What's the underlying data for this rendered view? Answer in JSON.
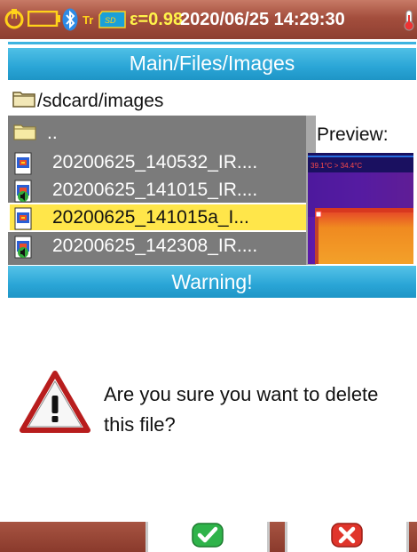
{
  "status_bar": {
    "emissivity": "ε=0.98",
    "datetime": "2020/06/25 14:29:30",
    "icons": [
      "power-plug-icon",
      "battery-icon",
      "bluetooth-icon",
      "temperature-unit-icon",
      "sd-card-icon",
      "thermometer-icon"
    ]
  },
  "header": {
    "breadcrumb": "Main/Files/Images"
  },
  "path": {
    "value": "/sdcard/images"
  },
  "file_list": {
    "items": [
      {
        "label": "..",
        "type": "folder",
        "selected": false
      },
      {
        "label": "20200625_140532_IR....",
        "type": "ir-image",
        "selected": false
      },
      {
        "label": "20200625_141015_IR....",
        "type": "ir-image-audio",
        "selected": false
      },
      {
        "label": "20200625_141015a_I...",
        "type": "ir-image",
        "selected": true
      },
      {
        "label": "20200625_142308_IR....",
        "type": "ir-image-audio",
        "selected": false
      }
    ]
  },
  "preview": {
    "label": "Preview:",
    "overlay_text": "39.1°C  > 34.4°C"
  },
  "dialog": {
    "title": "Warning!",
    "message": "Are you sure you want to delete this file?"
  },
  "buttons": {
    "confirm_icon": "check-icon",
    "cancel_icon": "cross-icon"
  },
  "colors": {
    "status_bar": "#a44e3d",
    "header_blue": "#2aa5d6",
    "selected_row": "#ffe64a",
    "list_bg": "#7b7b7b",
    "emissivity_text": "#fff34a",
    "confirm_green": "#2fb34a",
    "cancel_red": "#e0352b"
  }
}
